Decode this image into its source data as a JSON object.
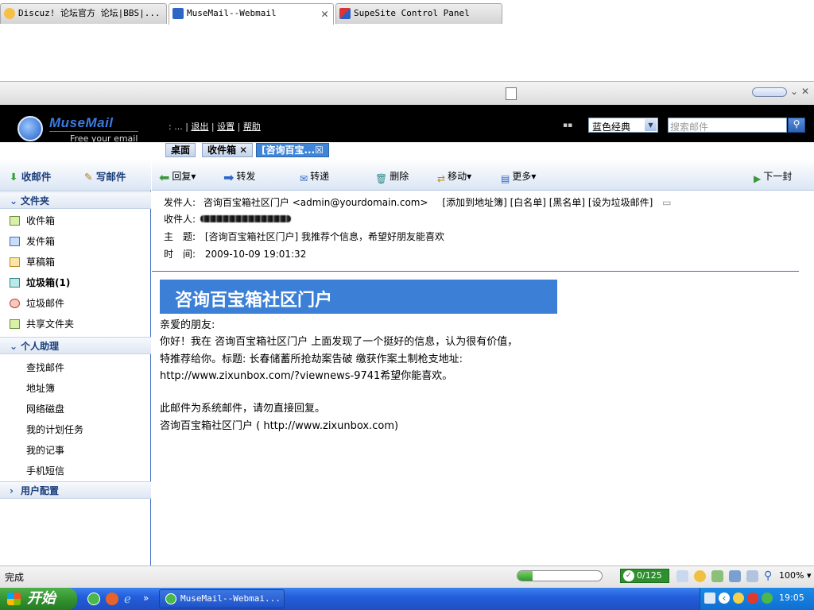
{
  "browser": {
    "tabs": [
      {
        "title": "Discuz! 论坛官方 论坛|BBS|..."
      },
      {
        "title": "MuseMail--Webmail"
      },
      {
        "title": "SupeSite Control Panel"
      }
    ],
    "close_glyph": "✕"
  },
  "app": {
    "logo": "MuseMail",
    "slogan": "Free your email",
    "top_links": [
      ": ...",
      "退出",
      "设置",
      "帮助"
    ],
    "skin_select": "蓝色经典",
    "search_placeholder": "搜索邮件",
    "tabs": [
      {
        "label": "桌面"
      },
      {
        "label": "收件箱 ✕"
      },
      {
        "label": "[咨询百宝...☒"
      }
    ]
  },
  "leftnav": {
    "receive": "收邮件",
    "compose": "写邮件",
    "folders_header": "文件夹",
    "folders": [
      "收件箱",
      "发件箱",
      "草稿箱",
      "垃圾箱(1)",
      "垃圾邮件",
      "共享文件夹"
    ],
    "assistant_header": "个人助理",
    "assistant": [
      "查找邮件",
      "地址簿",
      "网络磁盘",
      "我的计划任务",
      "我的记事",
      "手机短信"
    ],
    "config_header": "用户配置"
  },
  "toolbar": {
    "reply": "回复▾",
    "forward": "转发",
    "redirect": "转递",
    "delete": "删除",
    "move": "移动▾",
    "more": "更多▾",
    "next": "下一封"
  },
  "message": {
    "from_label": "发件人:",
    "from_value": "咨询百宝箱社区门户 <admin@yourdomain.com>",
    "from_actions": "[添加到地址簿] [白名单] [黑名单] [设为垃圾邮件]",
    "to_label": "收件人:",
    "subject_label": "主　题:",
    "subject_value": "[咨询百宝箱社区门户] 我推荐个信息，希望好朋友能喜欢",
    "time_label": "时　间:",
    "time_value": "2009-10-09 19:01:32",
    "banner": "咨询百宝箱社区门户",
    "body": [
      "亲爱的朋友:",
      "你好！我在 咨询百宝箱社区门户  上面发现了一个挺好的信息，认为很有价值，",
      "特推荐给你。标题: 长春储蓄所抢劫案告破 缴获作案土制枪支地址:",
      "http://www.zixunbox.com/?viewnews-9741希望你能喜欢。",
      "此邮件为系统邮件，请勿直接回复。",
      "咨询百宝箱社区门户 ( http://www.zixunbox.com)"
    ]
  },
  "statusbar": {
    "status": "完成",
    "progress": 0.18,
    "counter": "0/125",
    "zoom": "100%"
  },
  "taskbar": {
    "start": "开始",
    "task": "MuseMail--Webmai...",
    "clock": "19:05"
  },
  "colors": {
    "banner": "#3b7fd6",
    "header_bg": "#000000",
    "taskbar": "#245edb",
    "start": "#2f8f2d"
  }
}
